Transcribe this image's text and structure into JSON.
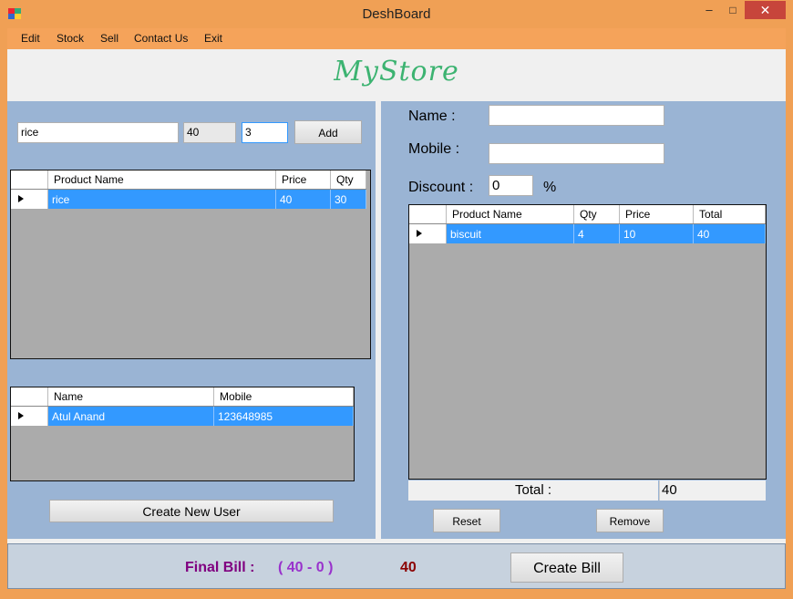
{
  "window": {
    "title": "DeshBoard",
    "min_glyph": "–",
    "max_glyph": "□",
    "close_glyph": "✕"
  },
  "menu": [
    "Edit",
    "Stock",
    "Sell",
    "Contact Us",
    "Exit"
  ],
  "logo": "MyStore",
  "product_entry": {
    "name_value": "rice",
    "price_value": "40",
    "qty_value": "3",
    "add_label": "Add"
  },
  "products_grid": {
    "columns": [
      "Product Name",
      "Price",
      "Qty"
    ],
    "rows": [
      [
        "rice",
        "40",
        "30"
      ]
    ]
  },
  "users_grid": {
    "columns": [
      "Name",
      "Mobile"
    ],
    "rows": [
      [
        "Atul Anand",
        "123648985"
      ]
    ]
  },
  "create_user_label": "Create New User",
  "customer": {
    "name_label": "Name :",
    "name_value": "",
    "mobile_label": "Mobile :",
    "mobile_value": "",
    "discount_label": "Discount :",
    "discount_value": "0",
    "percent_label": "%"
  },
  "cart_grid": {
    "columns": [
      "Product Name",
      "Qty",
      "Price",
      "Total"
    ],
    "rows": [
      [
        "biscuit",
        "4",
        "10",
        "40"
      ]
    ]
  },
  "total": {
    "label": "Total :",
    "value": "40"
  },
  "reset_label": "Reset",
  "remove_label": "Remove",
  "final_bill": {
    "label": "Final Bill :",
    "expression": "( 40 - 0 )",
    "amount": "40",
    "create_label": "Create Bill"
  },
  "colors": {
    "frame": "#f0a055",
    "panel": "#9ab4d4",
    "selection": "#3399ff",
    "logo": "#3cb371",
    "final_label": "#800080",
    "final_expr": "#9932cc",
    "final_amount": "#8b0000"
  },
  "icons": {
    "app": "app-icon"
  }
}
